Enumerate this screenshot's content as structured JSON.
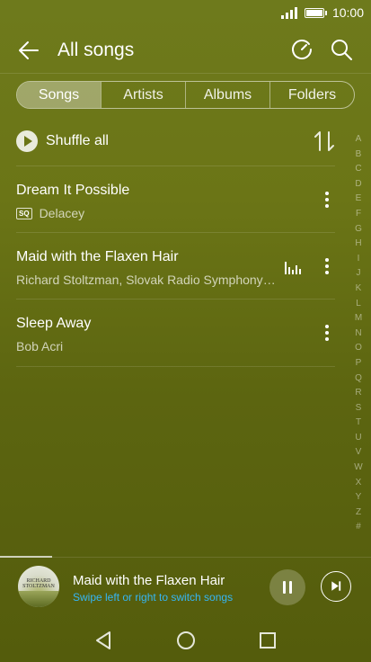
{
  "status_bar": {
    "time": "10:00"
  },
  "header": {
    "title": "All songs",
    "back_icon": "arrow-left-icon",
    "timer_icon": "sleep-timer-icon",
    "search_icon": "search-icon"
  },
  "tabs": [
    {
      "label": "Songs",
      "active": true
    },
    {
      "label": "Artists",
      "active": false
    },
    {
      "label": "Albums",
      "active": false
    },
    {
      "label": "Folders",
      "active": false
    }
  ],
  "shuffle": {
    "label": "Shuffle all"
  },
  "songs": [
    {
      "title": "Dream It Possible",
      "badge": "SQ",
      "artist": "Delacey",
      "playing": false
    },
    {
      "title": "Maid with the Flaxen Hair",
      "artist": "Richard Stoltzman, Slovak Radio Symphony Orchestra",
      "playing": true
    },
    {
      "title": "Sleep Away",
      "artist": "Bob Acri",
      "playing": false
    }
  ],
  "index_letters": [
    "A",
    "B",
    "C",
    "D",
    "E",
    "F",
    "G",
    "H",
    "I",
    "J",
    "K",
    "L",
    "M",
    "N",
    "O",
    "P",
    "Q",
    "R",
    "S",
    "T",
    "U",
    "V",
    "W",
    "X",
    "Y",
    "Z",
    "#"
  ],
  "player": {
    "title": "Maid with the Flaxen Hair",
    "hint": "Swipe left or right to switch songs",
    "cover_text": "RICHARD STOLTZMAN",
    "progress": 0.14
  },
  "colors": {
    "accent_hint": "#35b6f5"
  }
}
